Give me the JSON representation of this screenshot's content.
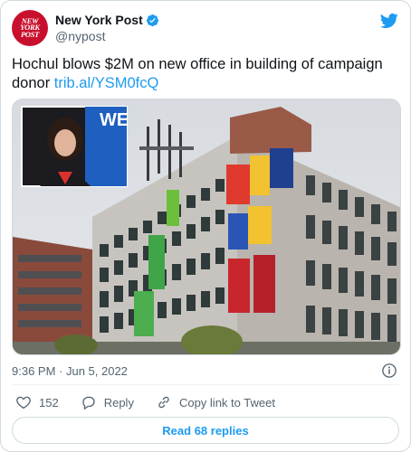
{
  "account": {
    "display_name": "New York Post",
    "handle": "@nypost",
    "avatar_text": [
      "NEW",
      "YORK",
      "POST"
    ]
  },
  "tweet": {
    "text": "Hochul blows $2M on new office in building of campaign donor ",
    "link": "trib.al/YSM0fcQ",
    "timestamp": "9:36 PM · Jun 5, 2022"
  },
  "media": {
    "inset_banner_text": "WE"
  },
  "actions": {
    "like_count": "152",
    "reply_label": "Reply",
    "copy_label": "Copy link to Tweet"
  },
  "footer": {
    "read_replies_label": "Read 68 replies"
  },
  "colors": {
    "accent": "#1d9bf0",
    "brand": "#c8102e",
    "secondary_text": "#536471"
  },
  "icons": [
    "verified-badge-icon",
    "twitter-bird-icon",
    "info-icon",
    "heart-icon",
    "reply-icon",
    "link-icon"
  ]
}
